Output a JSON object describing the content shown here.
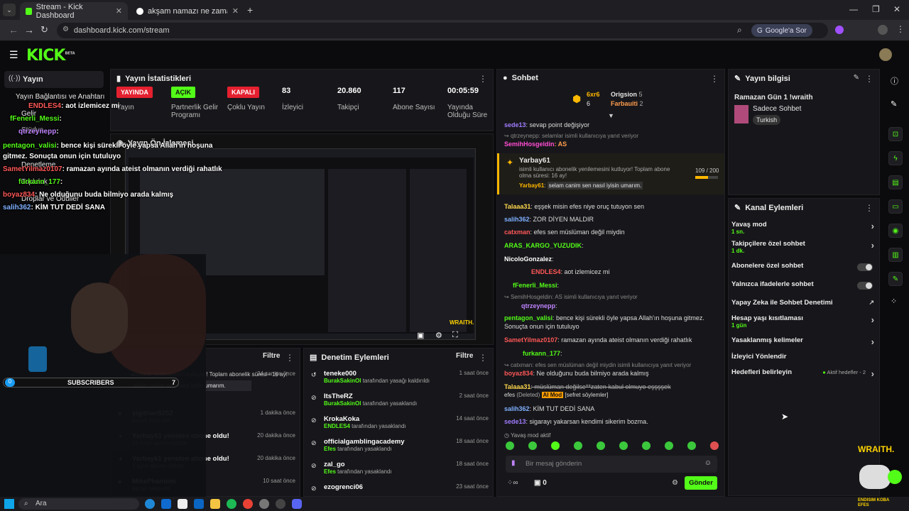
{
  "browser": {
    "tabs": [
      {
        "title": "Stream - Kick Dashboard"
      },
      {
        "title": "akşam namazı ne zaman - Goo..."
      }
    ],
    "url": "dashboard.kick.com/stream",
    "google_button": "Google'a Sor"
  },
  "brand": {
    "logo": "KICK",
    "beta": "BETA",
    "accent": "#53fc18"
  },
  "sidebar": {
    "section": "Yayın",
    "items": [
      {
        "label": "Yayın Bağlantısı ve Anahtarı"
      },
      {
        "label": "Gelir"
      },
      {
        "label": "Stüdyo"
      },
      {
        "label": "Denetleme"
      },
      {
        "label": "Topluluk"
      },
      {
        "label": "Droplar ve Ödüller"
      }
    ]
  },
  "stats": {
    "title": "Yayın İstatistikleri",
    "items": [
      {
        "value": "YAYINDA",
        "label": "Yayın"
      },
      {
        "value": "AÇIK",
        "label": "Partnerlik Gelir Programı"
      },
      {
        "value": "KAPALI",
        "label": "Çoklu Yayın"
      },
      {
        "value": "83",
        "label": "İzleyici"
      },
      {
        "value": "20.860",
        "label": "Takipçi"
      },
      {
        "value": "117",
        "label": "Abone Sayısı"
      },
      {
        "value": "00:05:59",
        "label": "Yayında Olduğu Süre"
      }
    ]
  },
  "preview": {
    "title": "Yayın Ön İzlemesi",
    "watermark": "WRAITH."
  },
  "overlay": {
    "chat": [
      {
        "user": "ENDLES4",
        "text": ": aot izlemicez mi"
      },
      {
        "user": "fFenerli_Messi",
        "text": ":"
      },
      {
        "user": "qtrzeynepp",
        "text": ":"
      },
      {
        "user": "pentagon_valisi",
        "text": ": bence kişi sürekli öyle yapsa Allah'ın hoşuna gitmez. Sonuçta onun için tutuluyo"
      },
      {
        "user": "SametYilmaz0107",
        "text": ": ramazan ayında ateist olmanın verdiği rahatlık"
      },
      {
        "user": "furkann_177",
        "text": ":"
      },
      {
        "user": "boyaz834",
        "text": ": Ne olduğunu buda bilmiyo arada kalmış"
      },
      {
        "user": "salih362",
        "text": ": KİM TUT DEDİ SANA"
      }
    ],
    "subs_count": "0",
    "subs_label": "SUBSCRIBERS",
    "sub_goal": "7"
  },
  "activity": {
    "title": "Filtre",
    "items": [
      {
        "name": "",
        "desc": "abonelik yenilemesini kutluyor! Toplam abonelik süresi - 16 ay!",
        "quote": "selam canim sen nasıl iyisin umarım.",
        "time": "34 saniye önce"
      },
      {
        "name": "yigithan5252",
        "desc": "kanalı takip etti",
        "time": "1 dakika önce"
      },
      {
        "name": "Yarbay61 yeniden abone oldu!",
        "desc": "16 aylık abone oldular",
        "time": "20 dakika önce"
      },
      {
        "name": "Yarbay61 yeniden abone oldu!",
        "desc": "1 aylık abone oldular",
        "time": "20 dakika önce"
      },
      {
        "name": "MikePhantom",
        "desc": "kanalı takip etti",
        "time": "10 saat önce"
      }
    ]
  },
  "moderation": {
    "title": "Denetim Eylemleri",
    "filter": "Filtre",
    "items": [
      {
        "name": "teneke000",
        "by": "BurakSakinOI",
        "action": "tarafından yasağı kaldırıldı",
        "time": "1 saat önce"
      },
      {
        "name": "ItsTheRZ",
        "by": "BurakSakinOI",
        "action": "tarafından yasaklandı",
        "time": "2 saat önce"
      },
      {
        "name": "KrokaKoka",
        "by": "ENDLES4",
        "action": "tarafından yasaklandı",
        "time": "14 saat önce"
      },
      {
        "name": "officialgamblingacademy",
        "by": "Efes",
        "action": "tarafından yasaklandı",
        "time": "18 saat önce"
      },
      {
        "name": "zal_go",
        "by": "Efes",
        "action": "tarafından yasaklandı",
        "time": "18 saat önce"
      },
      {
        "name": "ezogrenci06",
        "by": "",
        "action": "",
        "time": "23 saat önce"
      }
    ]
  },
  "chat": {
    "title": "Sohbet",
    "top": [
      {
        "name": "6xr6",
        "count": "6"
      },
      {
        "name": "Origsion",
        "count": "5"
      },
      {
        "name": "Farbauiti",
        "count": "2"
      }
    ],
    "messages": [
      {
        "user": "sede13",
        "text": ": sevap point değişiyor",
        "color": "#9f7bff"
      },
      {
        "reply": "qtrzeynepp: selamlar isimli kullanıcıya yanıt veriyor"
      },
      {
        "user": "SemihHosgeldin",
        "text": ": AS",
        "color": "#ff4dd2"
      }
    ],
    "resub": {
      "user": "Yarbay61",
      "text": "isimli kullanıcı abonelik yenilemesini kutluyor! Toplam abone olma süresi: 16 ay!",
      "progress": "109 / 200",
      "msg_user": "Yarbay61",
      "msg": "selam canim sen nasıl iyisin umarım."
    },
    "messages2": [
      {
        "user": "Talaaa31",
        "text": ": eşşek misin efes niye oruç tutuyon sen",
        "color": "#ffd84d"
      },
      {
        "user": "salih362",
        "text": ": ZOR DİYEN MALDIR",
        "color": "#7fb0ff"
      },
      {
        "user": "catxman",
        "text": ": efes sen müslüman değil miydin",
        "color": "#ff5757"
      },
      {
        "user": "ARAS_KARGO_YUZUDIK",
        "text": ":",
        "color": "#53fc18"
      },
      {
        "user": "NicoloGonzalez",
        "text": ":",
        "color": "#ffffff"
      },
      {
        "user": "ENDLES4",
        "text": ": aot izlemicez mi",
        "color": "#ff5757"
      },
      {
        "user": "fFenerli_Messi",
        "text": ":",
        "color": "#53fc18"
      },
      {
        "reply": "SemihHosgeldin: AS isimli kullanıcıya yanıt veriyor"
      },
      {
        "user": "qtrzeynepp",
        "text": ":",
        "color": "#c084ff"
      },
      {
        "user": "pentagon_valisi",
        "text": ": bence kişi sürekli öyle yapsa Allah'ın hoşuna gitmez. Sonuçta onun için tutuluyo",
        "color": "#53fc18"
      },
      {
        "user": "SametYilmaz0107",
        "text": ": ramazan ayında ateist olmanın verdiği rahatlık",
        "color": "#ff5757"
      },
      {
        "user": "furkann_177",
        "text": ":",
        "color": "#53fc18"
      },
      {
        "reply": "catxman: efes sen müslüman değil miydin isimli kullanıcıya yanıt veriyor"
      },
      {
        "user": "boyaz834",
        "text": ": Ne olduğunu buda bilmiyo arada kalmış",
        "color": "#ff5757"
      },
      {
        "user": "Talaaa31",
        "text": ": müslüman değilse**zaten kabul olmuyo eşşşşek",
        "color": "#ffd84d"
      },
      {
        "user": "efes",
        "text": "(Deleted)",
        "color": "#dddddd"
      },
      {
        "user": "salih362",
        "text": ": KİM TUT DEDİ SANA",
        "color": "#7fb0ff"
      },
      {
        "user": "sede13",
        "text": ": sigarayı yakarsan kendimi sikerim bozma.",
        "color": "#9f7bff"
      }
    ],
    "ai_mod": "AI Mod",
    "flag": "[sefret söylemler]",
    "slow_mode": "Yavaş mod aktif",
    "input_placeholder": "Bir mesaj gönderin",
    "send": "Gönder",
    "viewers_counter": "0"
  },
  "info": {
    "title": "Yayın bilgisi",
    "stream_title": "Ramazan Gün 1 !wraith",
    "category": "Sadece Sohbet",
    "tag": "Turkish"
  },
  "actions": {
    "title": "Kanal Eylemleri",
    "items": [
      {
        "label": "Yavaş mod",
        "sub": "1 sn.",
        "type": "chevron"
      },
      {
        "label": "Takipçilere özel sohbet",
        "sub": "1 dk.",
        "type": "chevron"
      },
      {
        "label": "Abonelere özel sohbet",
        "sub": "",
        "type": "toggle"
      },
      {
        "label": "Yalnızca ifadelerle sohbet",
        "sub": "",
        "type": "toggle"
      },
      {
        "label": "Yapay Zeka ile Sohbet Denetimi",
        "sub": "",
        "type": "external"
      },
      {
        "label": "Hesap yaşı kısıtlaması",
        "sub": "1 gün",
        "type": "chevron"
      },
      {
        "label": "Yasaklanmış kelimeler",
        "sub": "",
        "type": "chevron"
      },
      {
        "label": "İzleyici Yönlendir",
        "sub": "",
        "type": "none"
      },
      {
        "label": "Hedefleri belirleyin",
        "sub": "",
        "type": "chevron",
        "badge": "Aktif hedefler - 2"
      }
    ]
  },
  "webcam": {
    "watermark": "WRAITH.",
    "corner": "ENDISIM KOBA EFES"
  },
  "taskbar": {
    "search": "Ara"
  }
}
